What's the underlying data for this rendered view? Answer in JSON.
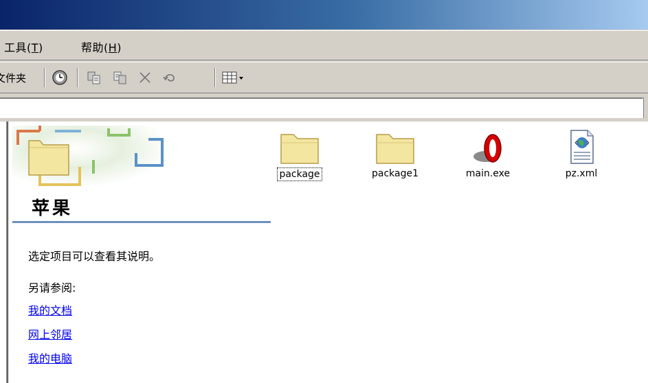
{
  "menubar": {
    "tools": "工具(",
    "tools_key": "T",
    "tools_close": ")",
    "help": "帮助(",
    "help_key": "H",
    "help_close": ")"
  },
  "toolbar": {
    "folders_label": "文件夹",
    "buttons": [
      "history-icon",
      "move-to-icon",
      "copy-to-icon",
      "delete-icon",
      "undo-icon",
      "views-icon"
    ]
  },
  "webview": {
    "folder_name": "苹果",
    "info": "选定项目可以查看其说明。",
    "see_also": "另请参阅:",
    "links": [
      "我的文档",
      "网上邻居",
      "我的电脑"
    ]
  },
  "files": [
    {
      "name": "package",
      "icon": "folder-icon",
      "focused": true
    },
    {
      "name": "package1",
      "icon": "folder-icon",
      "focused": false
    },
    {
      "name": "main.exe",
      "icon": "opera-exe-icon",
      "focused": false
    },
    {
      "name": "pz.xml",
      "icon": "xml-document-icon",
      "focused": false
    }
  ],
  "colors": {
    "title_start": "#0a246a",
    "title_end": "#a6caf0",
    "chrome": "#d4d0c8",
    "link": "#0000ee",
    "folder": "#f3e6a0"
  }
}
